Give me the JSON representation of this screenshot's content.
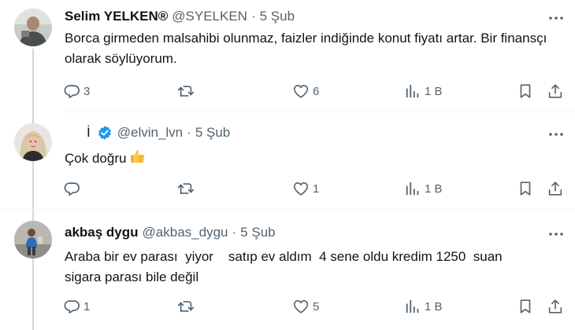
{
  "tweets": [
    {
      "name": "Selim YELKEN®",
      "handle": "@SYELKEN",
      "dot": "·",
      "time": "5 Şub",
      "text": "Borca girmeden malsahibi olunmaz, faizler indiğinde konut fiyatı artar. Bir finansçı olarak söylüyorum.",
      "replies": "3",
      "retweets": "",
      "likes": "6",
      "views": "1 B"
    },
    {
      "name": "İ",
      "handle": "@elvin_lvn",
      "dot": "·",
      "time": "5 Şub",
      "text": "Çok doğru",
      "replies": "",
      "retweets": "",
      "likes": "1",
      "views": "1 B"
    },
    {
      "name": "akbaş dygu",
      "handle": "@akbas_dygu",
      "dot": "·",
      "time": "5 Şub",
      "text": "Araba bir ev parası  yiyor    satıp ev aldım  4 sene oldu kredim 1250  suan sigara parası bile değil",
      "replies": "1",
      "retweets": "",
      "likes": "5",
      "views": "1 B"
    }
  ],
  "icons": {
    "reply": "reply-icon",
    "retweet": "retweet-icon",
    "like": "heart-icon",
    "views": "views-chart-icon",
    "bookmark": "bookmark-icon",
    "share": "share-icon",
    "more": "more-dots-icon",
    "verified": "verified-badge-icon",
    "emoji": "thumbs-up-emoji"
  },
  "colors": {
    "text": "#0f1419",
    "secondary": "#536471",
    "verified": "#1d9bf0",
    "divider": "#eff3f4",
    "thread_line": "#cfd9de"
  }
}
